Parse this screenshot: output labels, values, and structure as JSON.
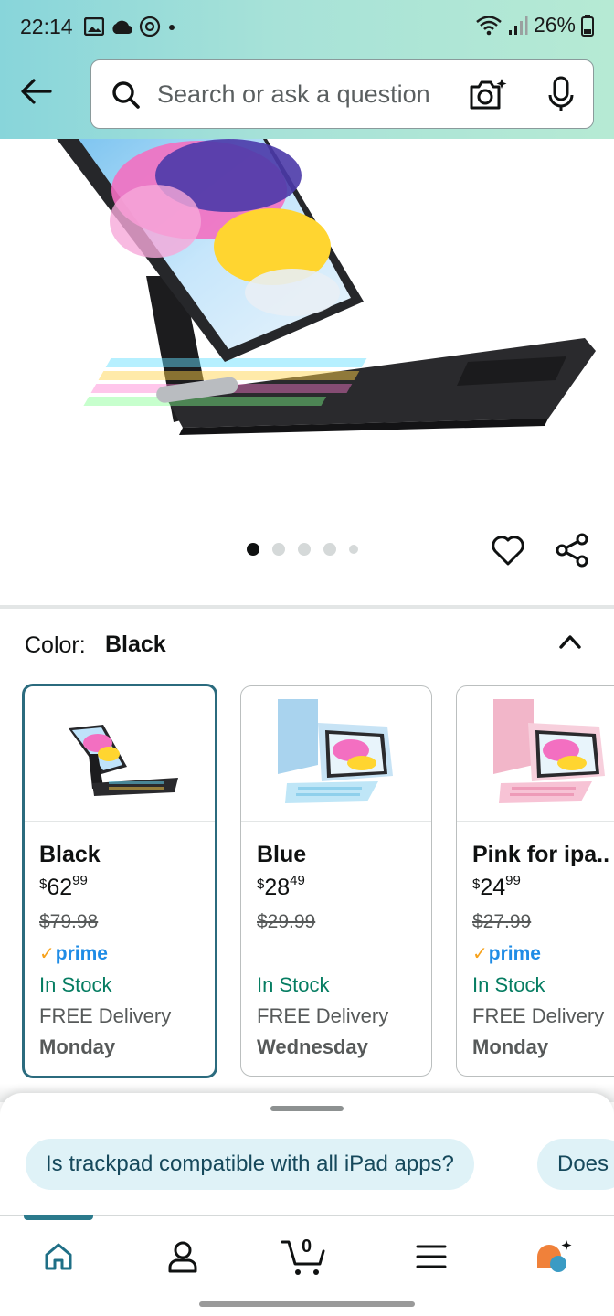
{
  "status_bar": {
    "time": "22:14",
    "battery": "26%"
  },
  "header": {
    "search_placeholder": "Search or ask a question"
  },
  "carousel": {
    "total_images": 5,
    "active_index": 0
  },
  "color_selector": {
    "label": "Color:",
    "selected": "Black"
  },
  "variants": [
    {
      "name": "Black",
      "price_currency": "$",
      "price_whole": "62",
      "price_fraction": "99",
      "list_price": "$79.98",
      "prime": "prime",
      "stock": "In Stock",
      "delivery": "FREE Delivery",
      "day": "Monday"
    },
    {
      "name": "Blue",
      "price_currency": "$",
      "price_whole": "28",
      "price_fraction": "49",
      "list_price": "$29.99",
      "stock": "In Stock",
      "delivery": "FREE Delivery",
      "day": "Wednesday"
    },
    {
      "name": "Pink for ipa..",
      "price_currency": "$",
      "price_whole": "24",
      "price_fraction": "99",
      "list_price": "$27.99",
      "prime": "prime",
      "stock": "In Stock",
      "delivery": "FREE Delivery",
      "day": "Monday"
    }
  ],
  "suggestions": [
    "Is trackpad compatible with all iPad apps?",
    "Does"
  ],
  "nav": {
    "cart_count": "0",
    "items": [
      "home-icon",
      "account-icon",
      "cart-icon",
      "menu-icon",
      "rufus-icon"
    ]
  },
  "colors": {
    "accent": "#2b6b7e",
    "stock_green": "#067d62",
    "prime_blue": "#1f8ce6",
    "chip_bg": "#dff2f7"
  }
}
